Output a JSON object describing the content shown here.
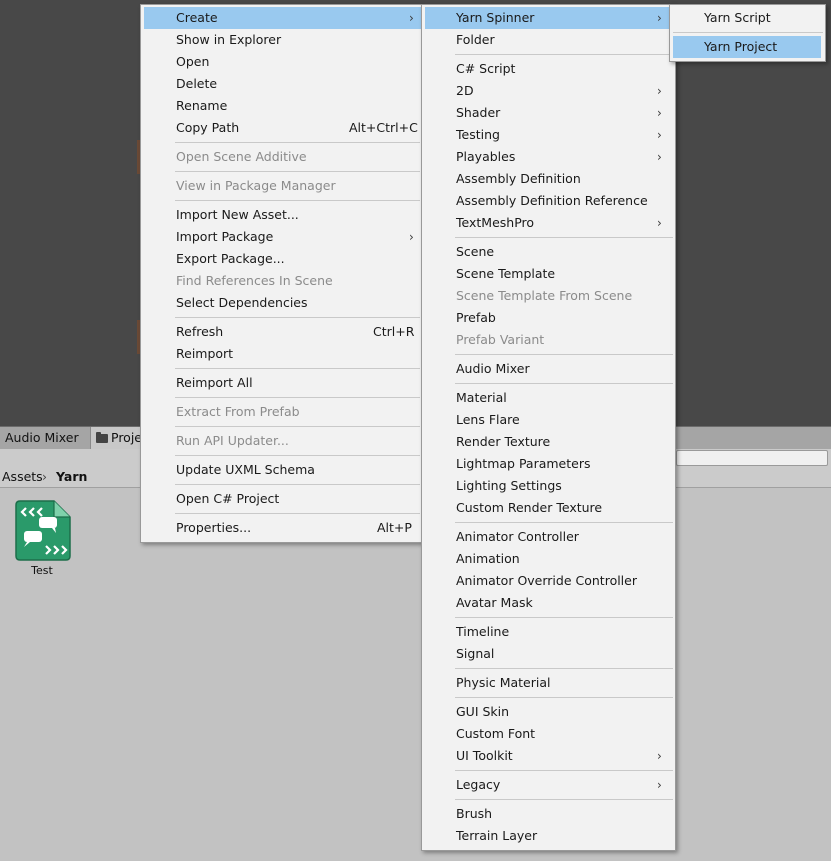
{
  "background": {
    "tabs": {
      "audio_mixer": "Audio Mixer",
      "project": "Proje"
    },
    "breadcrumb": {
      "root": "Assets",
      "separator": "›",
      "current": "Yarn"
    },
    "asset": {
      "label": "Test",
      "icon": "yarn-script-icon",
      "icon_color": "#2a9a6a"
    }
  },
  "colors": {
    "highlight": "#99c9ef",
    "menu_bg": "#f2f2f2",
    "disabled_text": "#8b8b8b"
  },
  "main_menu": {
    "create": "Create",
    "show_in_explorer": "Show in Explorer",
    "open": "Open",
    "delete": "Delete",
    "rename": "Rename",
    "copy_path": "Copy Path",
    "copy_path_shortcut": "Alt+Ctrl+C",
    "open_scene_additive": "Open Scene Additive",
    "view_in_package_manager": "View in Package Manager",
    "import_new_asset": "Import New Asset...",
    "import_package": "Import Package",
    "export_package": "Export Package...",
    "find_references": "Find References In Scene",
    "select_dependencies": "Select Dependencies",
    "refresh": "Refresh",
    "refresh_shortcut": "Ctrl+R",
    "reimport": "Reimport",
    "reimport_all": "Reimport All",
    "extract_from_prefab": "Extract From Prefab",
    "run_api_updater": "Run API Updater...",
    "update_uxml_schema": "Update UXML Schema",
    "open_csharp_project": "Open C# Project",
    "properties": "Properties...",
    "properties_shortcut": "Alt+P"
  },
  "create_menu": {
    "yarn_spinner": "Yarn Spinner",
    "folder": "Folder",
    "csharp_script": "C# Script",
    "2d": "2D",
    "shader": "Shader",
    "testing": "Testing",
    "playables": "Playables",
    "assembly_definition": "Assembly Definition",
    "assembly_definition_reference": "Assembly Definition Reference",
    "textmeshpro": "TextMeshPro",
    "scene": "Scene",
    "scene_template": "Scene Template",
    "scene_template_from_scene": "Scene Template From Scene",
    "prefab": "Prefab",
    "prefab_variant": "Prefab Variant",
    "audio_mixer": "Audio Mixer",
    "material": "Material",
    "lens_flare": "Lens Flare",
    "render_texture": "Render Texture",
    "lightmap_parameters": "Lightmap Parameters",
    "lighting_settings": "Lighting Settings",
    "custom_render_texture": "Custom Render Texture",
    "animator_controller": "Animator Controller",
    "animation": "Animation",
    "animator_override_controller": "Animator Override Controller",
    "avatar_mask": "Avatar Mask",
    "timeline": "Timeline",
    "signal": "Signal",
    "physic_material": "Physic Material",
    "gui_skin": "GUI Skin",
    "custom_font": "Custom Font",
    "ui_toolkit": "UI Toolkit",
    "legacy": "Legacy",
    "brush": "Brush",
    "terrain_layer": "Terrain Layer"
  },
  "yarn_menu": {
    "yarn_script": "Yarn Script",
    "yarn_project": "Yarn Project"
  }
}
